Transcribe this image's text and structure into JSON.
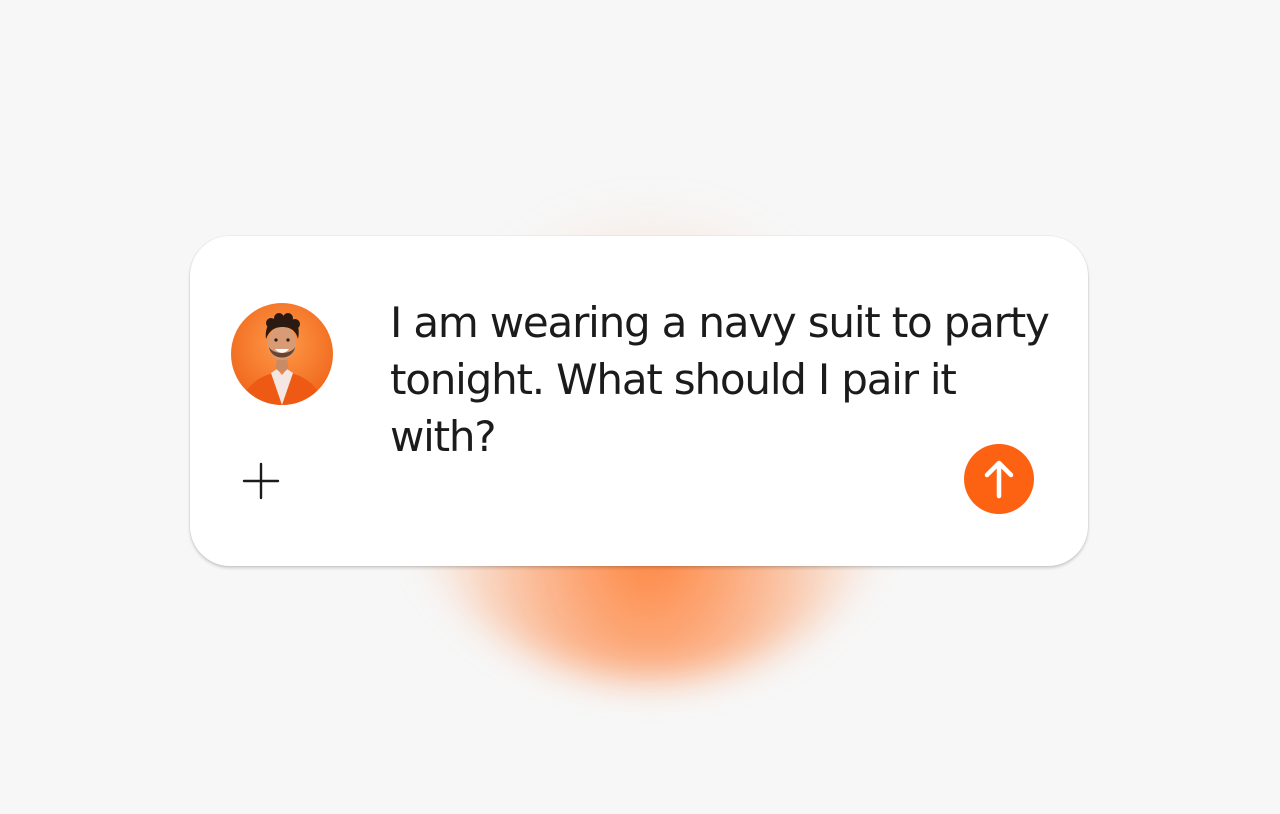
{
  "composer": {
    "message_text": "I am wearing a navy suit to party tonight. What should I pair it with?",
    "avatar_icon": "user-avatar-photo",
    "attach_icon": "plus-icon",
    "send_icon": "arrow-up-icon"
  },
  "colors": {
    "accent": "#fd6212",
    "card_background": "#ffffff",
    "page_background": "#f7f7f7",
    "text": "#1b1b1b"
  }
}
